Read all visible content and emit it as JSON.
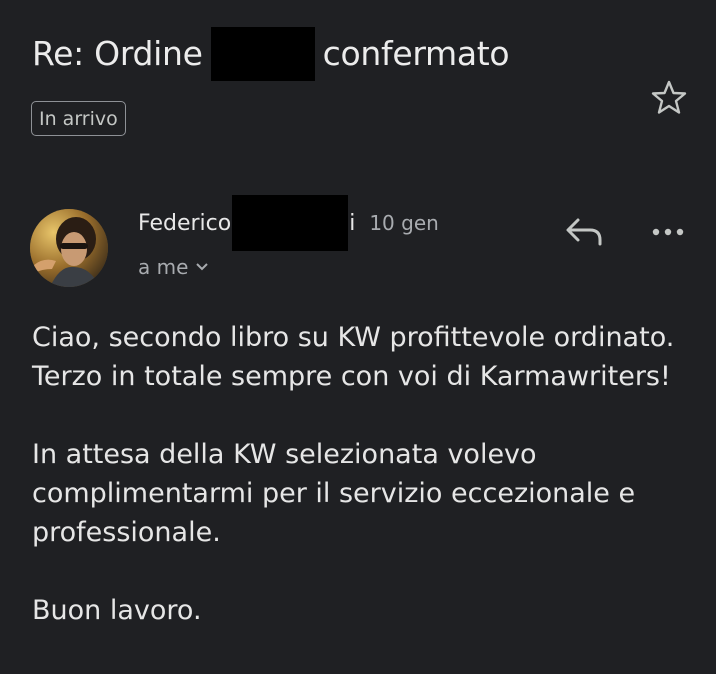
{
  "email": {
    "subject_prefix": "Re: Ordine",
    "subject_suffix": "confermato",
    "label": "In arrivo",
    "sender_name": "Federico",
    "sender_tail": "i",
    "date": "10 gen",
    "recipient": "a me",
    "body": [
      "Ciao, secondo libro su KW profittevole ordinato. Terzo in totale sempre con voi di Karmawriters!",
      "In attesa della KW selezionata volevo complimentarmi per il servizio eccezionale e professionale.",
      "Buon lavoro."
    ]
  },
  "icons": {
    "star": "star-icon",
    "reply": "reply-icon",
    "more": "more-options-icon",
    "expand": "chevron-down-icon"
  },
  "colors": {
    "background": "#1f2023",
    "text": "#e3e3e3",
    "muted": "#a8abaf"
  }
}
